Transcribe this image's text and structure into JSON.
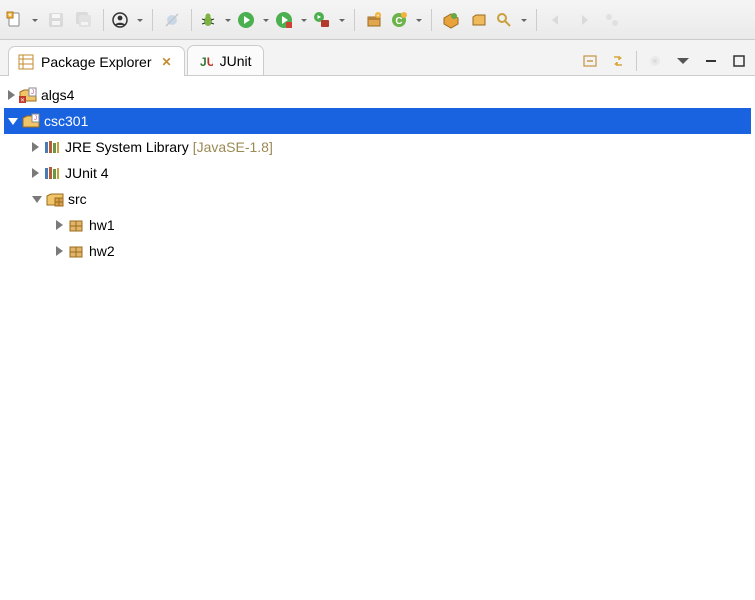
{
  "toolbar": {
    "new_wizard": "New",
    "save": "Save",
    "save_all": "Save All",
    "user": "User",
    "skip_breakpoints": "Skip Breakpoints",
    "debug": "Debug",
    "run": "Run",
    "coverage": "Coverage",
    "external_tools": "External Tools",
    "new_pkg": "New Package",
    "new_class": "New Class",
    "open_type": "Open Type",
    "open_task": "Open Task",
    "search": "Search"
  },
  "tabs": {
    "package_explorer": {
      "label": "Package Explorer",
      "active": true
    },
    "junit": {
      "label": "JUnit",
      "active": false
    }
  },
  "tabControls": {
    "collapse": "Collapse All",
    "link": "Link with Editor",
    "focus": "Focus",
    "view_menu": "View Menu",
    "minimize": "Minimize",
    "maximize": "Maximize"
  },
  "tree": {
    "algs4": {
      "label": "algs4",
      "expanded": false
    },
    "csc301": {
      "label": "csc301",
      "expanded": true,
      "selected": true
    },
    "jre": {
      "label": "JRE System Library",
      "annotation": "[JavaSE-1.8]",
      "expanded": false
    },
    "junit4": {
      "label": "JUnit 4",
      "expanded": false
    },
    "src": {
      "label": "src",
      "expanded": true
    },
    "hw1": {
      "label": "hw1"
    },
    "hw2": {
      "label": "hw2"
    }
  }
}
